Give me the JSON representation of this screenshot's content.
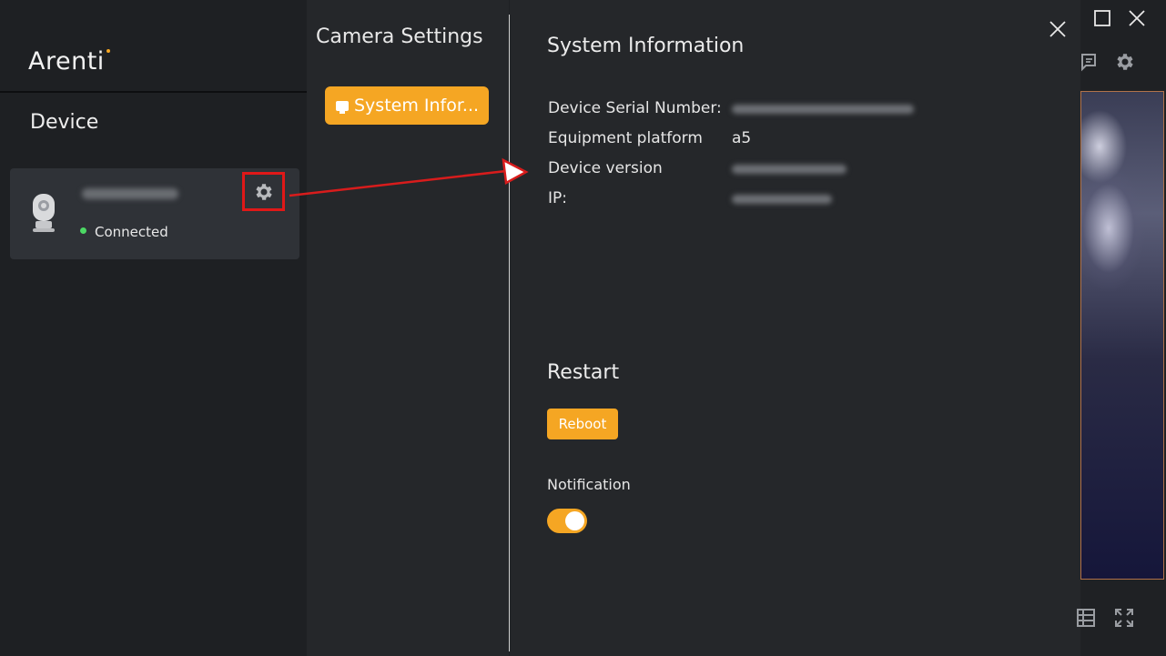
{
  "app": {
    "logo_text": "Arenti",
    "accent_color": "#f5a623"
  },
  "sidebar": {
    "section_title": "Device",
    "device_card": {
      "status_text": "Connected",
      "status_color": "#4cd964",
      "settings_icon": "gear-icon",
      "camera_icon": "security-camera-icon"
    }
  },
  "settings_panel": {
    "title": "Camera Settings",
    "menu": [
      {
        "label": "System Infor...",
        "icon": "monitor-icon",
        "selected": true
      }
    ]
  },
  "main": {
    "close_icon": "close-icon",
    "system_info": {
      "heading": "System Information",
      "rows": [
        {
          "label": "Device Serial Number:",
          "value_visible": false
        },
        {
          "label": "Equipment platform",
          "value": "a5",
          "value_visible": true
        },
        {
          "label": "Device version",
          "value_visible": false
        },
        {
          "label": "IP:",
          "value_visible": false
        }
      ]
    },
    "restart": {
      "heading": "Restart",
      "button_label": "Reboot"
    },
    "notification": {
      "label": "Notification",
      "enabled": true
    }
  },
  "background_window": {
    "icons": [
      "maximize-icon",
      "close-icon",
      "chat-icon",
      "gear-icon",
      "grid-view-icon",
      "fullscreen-icon"
    ]
  }
}
